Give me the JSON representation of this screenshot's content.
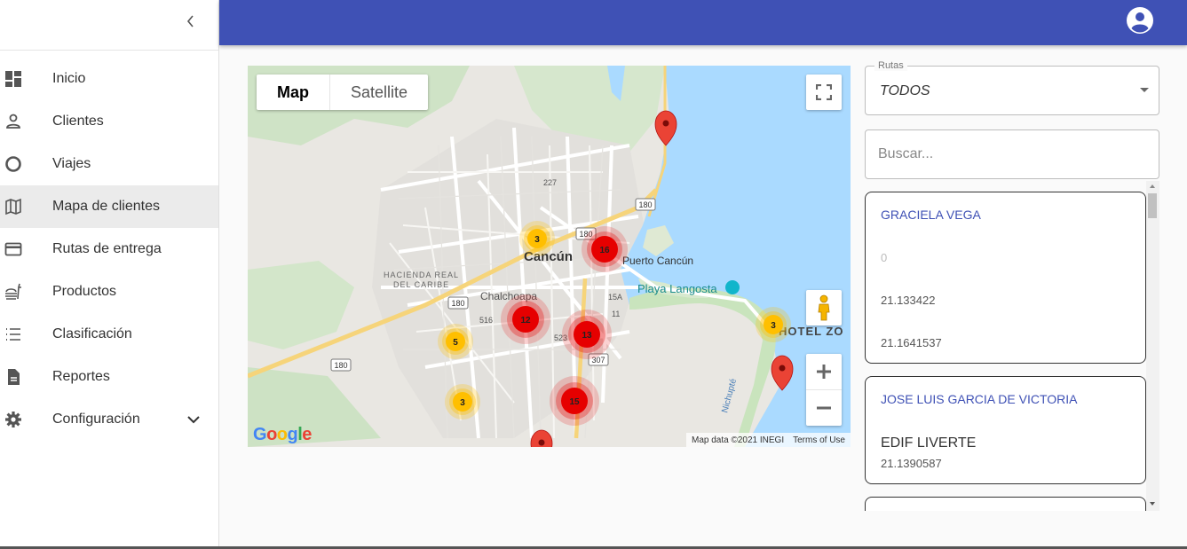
{
  "sidebar": {
    "items": [
      {
        "label": "Inicio",
        "icon": "dashboard-icon"
      },
      {
        "label": "Clientes",
        "icon": "person-icon"
      },
      {
        "label": "Viajes",
        "icon": "circle-icon"
      },
      {
        "label": "Mapa de clientes",
        "icon": "map-icon",
        "active": true
      },
      {
        "label": "Rutas de entrega",
        "icon": "credit-card-icon"
      },
      {
        "label": "Productos",
        "icon": "fastfood-icon"
      },
      {
        "label": "Clasificación",
        "icon": "list-icon"
      },
      {
        "label": "Reportes",
        "icon": "description-icon"
      },
      {
        "label": "Configuración",
        "icon": "gear-icon"
      }
    ]
  },
  "colors": {
    "appbar": "#3f51b5",
    "accent": "#3f51b5",
    "cluster_red": "#e60000",
    "cluster_yellow": "#ffbf00",
    "marker": "#ea4335"
  },
  "map": {
    "type_buttons": [
      "Map",
      "Satellite"
    ],
    "selected_type": "Map",
    "labels": {
      "city": "Cancún",
      "puerto": "Puerto Cancún",
      "hacienda_1": "HACIENDA REAL",
      "hacienda_2": "DEL CARIBE",
      "chalchoapa": "Chalchoapa",
      "playa": "Playa Langosta",
      "hotel": "HOTEL ZO",
      "nichupte": "Nichupté",
      "r227": "227",
      "r180a": "180",
      "r180b": "180",
      "r180c": "180",
      "r180d": "180",
      "r516": "516",
      "r523": "523",
      "r307": "307",
      "r15a": "15A",
      "r11": "11"
    },
    "clusters": [
      "3",
      "16",
      "12",
      "5",
      "13",
      "3",
      "15",
      "3"
    ],
    "attribution": "Map data ©2021 INEGI",
    "terms": "Terms of Use",
    "logo": "Google"
  },
  "rutas": {
    "label": "Rutas",
    "value": "TODOS"
  },
  "search": {
    "placeholder": "Buscar..."
  },
  "clients": [
    {
      "name": "GRACIELA VEGA",
      "line1": "0",
      "line2": "21.133422",
      "line3": "21.1641537"
    },
    {
      "name": "JOSE LUIS GARCIA DE VICTORIA",
      "line1": "EDIF LIVERTE",
      "line2": "21.1390587"
    }
  ]
}
